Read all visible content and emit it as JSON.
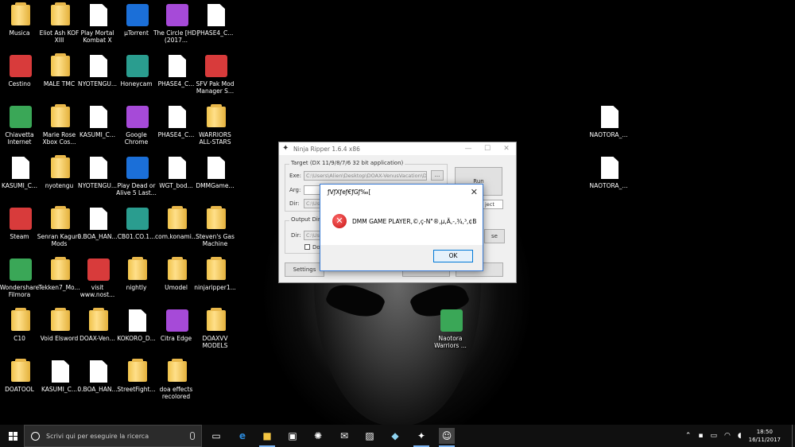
{
  "desktop_icons": [
    {
      "label": "Musica",
      "type": "folder"
    },
    {
      "label": "Eliot Ash KOF XIII",
      "type": "folder"
    },
    {
      "label": "Play Mortal Kombat X",
      "type": "doc"
    },
    {
      "label": "µTorrent",
      "type": "app"
    },
    {
      "label": "The Circle [HD] (2017...",
      "type": "app"
    },
    {
      "label": "PHASE4_C...",
      "type": "doc"
    },
    {
      "label": "Cestino",
      "type": "app"
    },
    {
      "label": "MALE TMC",
      "type": "folder"
    },
    {
      "label": "NYOTENGU...",
      "type": "doc"
    },
    {
      "label": "Honeycam",
      "type": "app"
    },
    {
      "label": "PHASE4_C...",
      "type": "doc"
    },
    {
      "label": "SFV Pak Mod Manager S...",
      "type": "app"
    },
    {
      "label": "Chiavetta Internet",
      "type": "app"
    },
    {
      "label": "Marie Rose Xbox Cos...",
      "type": "folder"
    },
    {
      "label": "KASUMI_C...",
      "type": "doc"
    },
    {
      "label": "Google Chrome",
      "type": "app"
    },
    {
      "label": "PHASE4_C...",
      "type": "doc"
    },
    {
      "label": "WARRIORS ALL-STARS",
      "type": "folder"
    },
    {
      "label": "KASUMI_C...",
      "type": "doc"
    },
    {
      "label": "nyotengu",
      "type": "folder"
    },
    {
      "label": "NYOTENGU...",
      "type": "doc"
    },
    {
      "label": "Play Dead or Alive 5 Last...",
      "type": "app"
    },
    {
      "label": "WGT_bod...",
      "type": "doc"
    },
    {
      "label": "DMMGame...",
      "type": "doc"
    },
    {
      "label": "Steam",
      "type": "app"
    },
    {
      "label": "Senran Kagura Mods",
      "type": "folder"
    },
    {
      "label": "0.BOA_HAN...",
      "type": "doc"
    },
    {
      "label": "CB01.CO.1...",
      "type": "app"
    },
    {
      "label": "com.konami...",
      "type": "folder"
    },
    {
      "label": "Steven's Gas Machine",
      "type": "folder"
    },
    {
      "label": "Wondershare Filmora",
      "type": "app"
    },
    {
      "label": "Tekken7_Mo...",
      "type": "folder"
    },
    {
      "label": "visit www.nost...",
      "type": "app"
    },
    {
      "label": "nightly",
      "type": "folder"
    },
    {
      "label": "Umodel",
      "type": "folder"
    },
    {
      "label": "ninjaripper1...",
      "type": "folder"
    },
    {
      "label": "C10",
      "type": "folder"
    },
    {
      "label": "Void Elsword",
      "type": "folder"
    },
    {
      "label": "DOAX-Ven...",
      "type": "folder"
    },
    {
      "label": "KOKORO_D...",
      "type": "doc"
    },
    {
      "label": "Citra Edge",
      "type": "app"
    },
    {
      "label": "DOAXVV MODELS",
      "type": "folder"
    },
    {
      "label": "DOATOOL",
      "type": "folder"
    },
    {
      "label": "KASUMI_C...",
      "type": "doc"
    },
    {
      "label": "0.BOA_HAN...",
      "type": "doc"
    },
    {
      "label": "StreetFight...",
      "type": "folder"
    },
    {
      "label": "doa effects recolored",
      "type": "folder"
    }
  ],
  "right_icons": [
    {
      "label": "NAOTORA_...",
      "type": "doc"
    },
    {
      "label": "NAOTORA_...",
      "type": "doc"
    },
    {
      "label": "Naotora Warriors ...",
      "type": "app"
    }
  ],
  "ninja_ripper": {
    "title": "Ninja Ripper 1.6.4 x86",
    "target_group": "Target (DX 11/9/8/7/6 32 bit application)",
    "exe_label": "Exe:",
    "exe_value": "C:\\Users\\Alien\\Desktop\\DOAX-VenusVacation\\DO",
    "browse": "...",
    "arg_label": "Arg:",
    "dir_label": "Dir:",
    "dir_value": "C:\\Us",
    "run_button": "Run",
    "inject_select": "ject",
    "output_group": "Output Direc",
    "out_dir_label": "Dir:",
    "out_dir_value": "C:\\Us",
    "checkbox_label": "Do",
    "browse_btn2": "se",
    "settings_button": "Settings"
  },
  "error_dialog": {
    "title": "ƒVƒXƒeƒ€ƒGƒ‰[",
    "message": "DMM GAME PLAYER,©,ç-N\"®,µ,Ä,-,¾,³,¢B",
    "ok_button": "OK",
    "icon": "error-icon"
  },
  "taskbar": {
    "search_placeholder": "Scrivi qui per eseguire la ricerca",
    "time": "18:50",
    "date": "16/11/2017"
  }
}
